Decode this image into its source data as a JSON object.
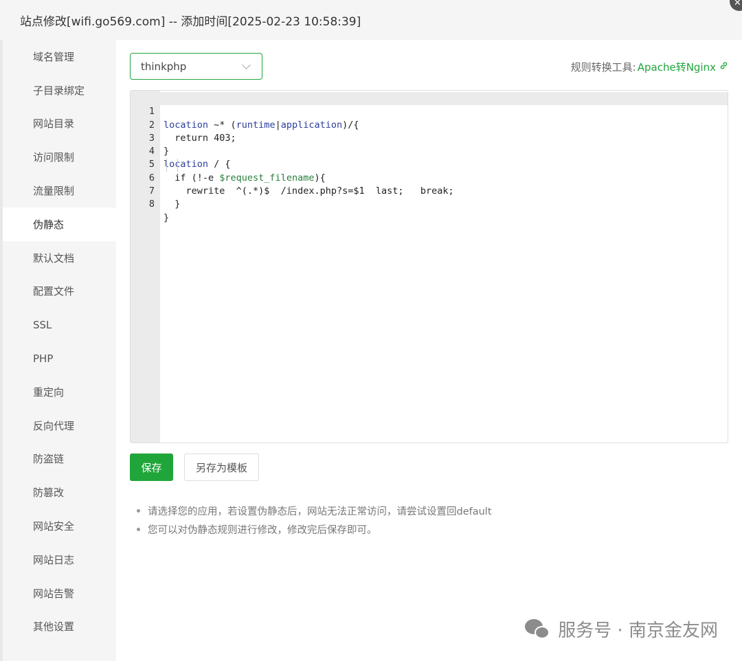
{
  "window": {
    "title": "站点修改[wifi.go569.com] -- 添加时间[2025-02-23 10:58:39]",
    "close_symbol": "✕"
  },
  "sidebar": {
    "items": [
      {
        "label": "域名管理"
      },
      {
        "label": "子目录绑定"
      },
      {
        "label": "网站目录"
      },
      {
        "label": "访问限制"
      },
      {
        "label": "流量限制"
      },
      {
        "label": "伪静态",
        "active": true
      },
      {
        "label": "默认文档"
      },
      {
        "label": "配置文件"
      },
      {
        "label": "SSL"
      },
      {
        "label": "PHP"
      },
      {
        "label": "重定向"
      },
      {
        "label": "反向代理"
      },
      {
        "label": "防盗链"
      },
      {
        "label": "防篡改"
      },
      {
        "label": "网站安全"
      },
      {
        "label": "网站日志"
      },
      {
        "label": "网站告警"
      },
      {
        "label": "其他设置"
      }
    ]
  },
  "rewrite": {
    "selected_template": "thinkphp",
    "tool_label": "规则转换工具:",
    "tool_link": "Apache转Nginx",
    "link_icon": "link-icon"
  },
  "editor": {
    "lines": [
      {
        "n": "1",
        "text": "location ~* (runtime|application)/{"
      },
      {
        "n": "2",
        "text": "  return 403;"
      },
      {
        "n": "3",
        "text": "}"
      },
      {
        "n": "4",
        "text": "location / {"
      },
      {
        "n": "5",
        "text": "  if (!-e $request_filename){"
      },
      {
        "n": "6",
        "text": "    rewrite  ^(.*)$  /index.php?s=$1  last;   break;"
      },
      {
        "n": "7",
        "text": "  }"
      },
      {
        "n": "8",
        "text": "}"
      }
    ]
  },
  "buttons": {
    "save": "保存",
    "save_as_template": "另存为模板"
  },
  "tips": [
    "请选择您的应用，若设置伪静态后，网站无法正常访问，请尝试设置回default",
    "您可以对伪静态规则进行修改，修改完后保存即可。"
  ],
  "watermark": {
    "text": "服务号 · 南京金友网",
    "icon": "wechat-icon"
  },
  "colors": {
    "accent": "#20a53a",
    "keyword": "#2b3d9c",
    "variable": "#2a7d3c"
  }
}
